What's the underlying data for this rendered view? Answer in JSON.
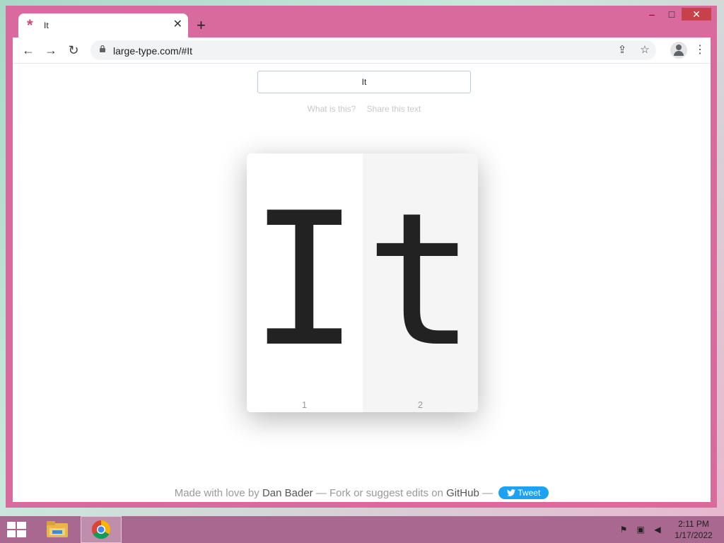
{
  "browser": {
    "tab_title": "It",
    "url": "large-type.com/#It",
    "new_tab_symbol": "+",
    "tab_close_symbol": "✕",
    "window_controls": {
      "minimize": "–",
      "maximize": "□",
      "close": "✕"
    }
  },
  "toolbar": {
    "back": "←",
    "forward": "→",
    "reload": "↻",
    "share": "⇪",
    "star": "☆",
    "menu": "⋮"
  },
  "page": {
    "input_value": "It",
    "help_links": [
      "What is this?",
      "Share this text"
    ],
    "characters": [
      {
        "glyph": "I",
        "number": "1"
      },
      {
        "glyph": "t",
        "number": "2"
      }
    ],
    "footer": {
      "made_with": "Made with love by",
      "author": "Dan Bader",
      "dash1": "— Fork or suggest edits on",
      "github": "GitHub",
      "dash2": "—",
      "tweet": "Tweet"
    }
  },
  "taskbar": {
    "time": "2:11 PM",
    "date": "1/17/2022"
  },
  "colors": {
    "window_frame": "#d86a9e",
    "tweet_button": "#1da1f2",
    "taskbar": "#a9688f"
  }
}
